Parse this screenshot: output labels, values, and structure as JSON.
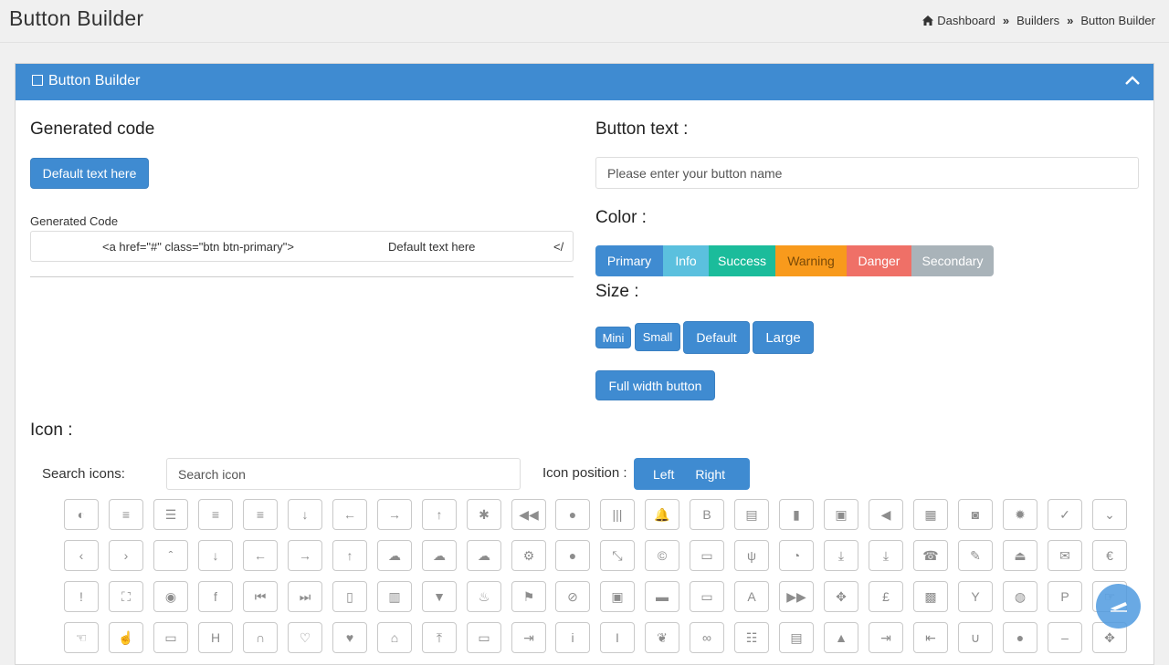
{
  "header": {
    "title": "Button Builder",
    "breadcrumb": [
      "Dashboard",
      "Builders",
      "Button Builder"
    ],
    "separator": "»"
  },
  "card": {
    "title": "Button Builder",
    "accent": "#3f8bd1"
  },
  "generated": {
    "heading": "Generated code",
    "preview_label": "Default text here",
    "code_label": "Generated Code",
    "code_open": "<a href=\"#\" class=\"btn btn-primary\">",
    "code_text": "Default text here",
    "code_close": "</"
  },
  "button_text": {
    "heading": "Button text :",
    "placeholder": "Please enter your button name"
  },
  "color": {
    "heading": "Color :",
    "options": [
      {
        "label": "Primary",
        "color": "#3f8bd1"
      },
      {
        "label": "Info",
        "color": "#5bc0de"
      },
      {
        "label": "Success",
        "color": "#1bbc9b"
      },
      {
        "label": "Warning",
        "color": "#f89a1c"
      },
      {
        "label": "Danger",
        "color": "#ef7067"
      },
      {
        "label": "Secondary",
        "color": "#a9b3b9"
      }
    ]
  },
  "size": {
    "heading": "Size :",
    "options": [
      "Mini",
      "Small",
      "Default",
      "Large"
    ],
    "full_width": "Full width button"
  },
  "icon": {
    "heading": "Icon :",
    "search_label": "Search icons:",
    "search_placeholder": "Search icon",
    "position_label": "Icon position :",
    "position_options": [
      "Left",
      "Right"
    ],
    "rows": [
      [
        "adjust-icon",
        "align-center-icon",
        "align-justify-icon",
        "align-left-icon",
        "align-right-icon",
        "arrow-down-icon",
        "arrow-left-icon",
        "arrow-right-icon",
        "arrow-up-icon",
        "asterisk-icon",
        "backward-icon",
        "circle-icon",
        "barcode-icon",
        "bell-icon",
        "bold-icon",
        "book-icon",
        "bookmark-icon",
        "briefcase-icon",
        "bullhorn-icon",
        "calendar-icon",
        "camera-icon",
        "certificate-icon",
        "check-icon",
        "chevron-down-icon"
      ],
      [
        "chevron-left-icon",
        "chevron-right-icon",
        "chevron-up-icon",
        "arrow-down-icon",
        "arrow-left-icon",
        "arrow-right-icon",
        "arrow-up-icon",
        "cloud-icon",
        "cloud-download-icon",
        "cloud-upload-icon",
        "cog-icon",
        "comment-icon",
        "compress-icon",
        "copyright-icon",
        "credit-card-icon",
        "cutlery-icon",
        "dashboard-icon",
        "download-icon",
        "download-alt-icon",
        "phone-icon",
        "edit-icon",
        "eject-icon",
        "envelope-icon",
        "euro-icon"
      ],
      [
        "exclamation-icon",
        "expand-icon",
        "eye-icon",
        "facebook-icon",
        "fast-backward-icon",
        "fast-forward-icon",
        "file-icon",
        "film-icon",
        "filter-icon",
        "fire-icon",
        "flag-icon",
        "eye-slash-icon",
        "save-icon",
        "folder-icon",
        "folder-open-icon",
        "font-icon",
        "forward-icon",
        "move-icon",
        "pound-icon",
        "gift-icon",
        "glass-icon",
        "globe-icon",
        "paypal-icon",
        "hand-right-icon"
      ],
      [
        "hand-left-icon",
        "hand-up-icon",
        "hdd-icon",
        "header-icon",
        "headphones-icon",
        "heart-empty-icon",
        "heart-icon",
        "home-icon",
        "upload-icon",
        "inbox-icon",
        "indent-icon",
        "info-icon",
        "italic-icon",
        "leaf-icon",
        "link-icon",
        "list-icon",
        "list-alt-icon",
        "lock-icon",
        "log-in-icon",
        "log-out-icon",
        "magnet-icon",
        "map-marker-icon",
        "minus-icon",
        "move-icon"
      ]
    ]
  }
}
